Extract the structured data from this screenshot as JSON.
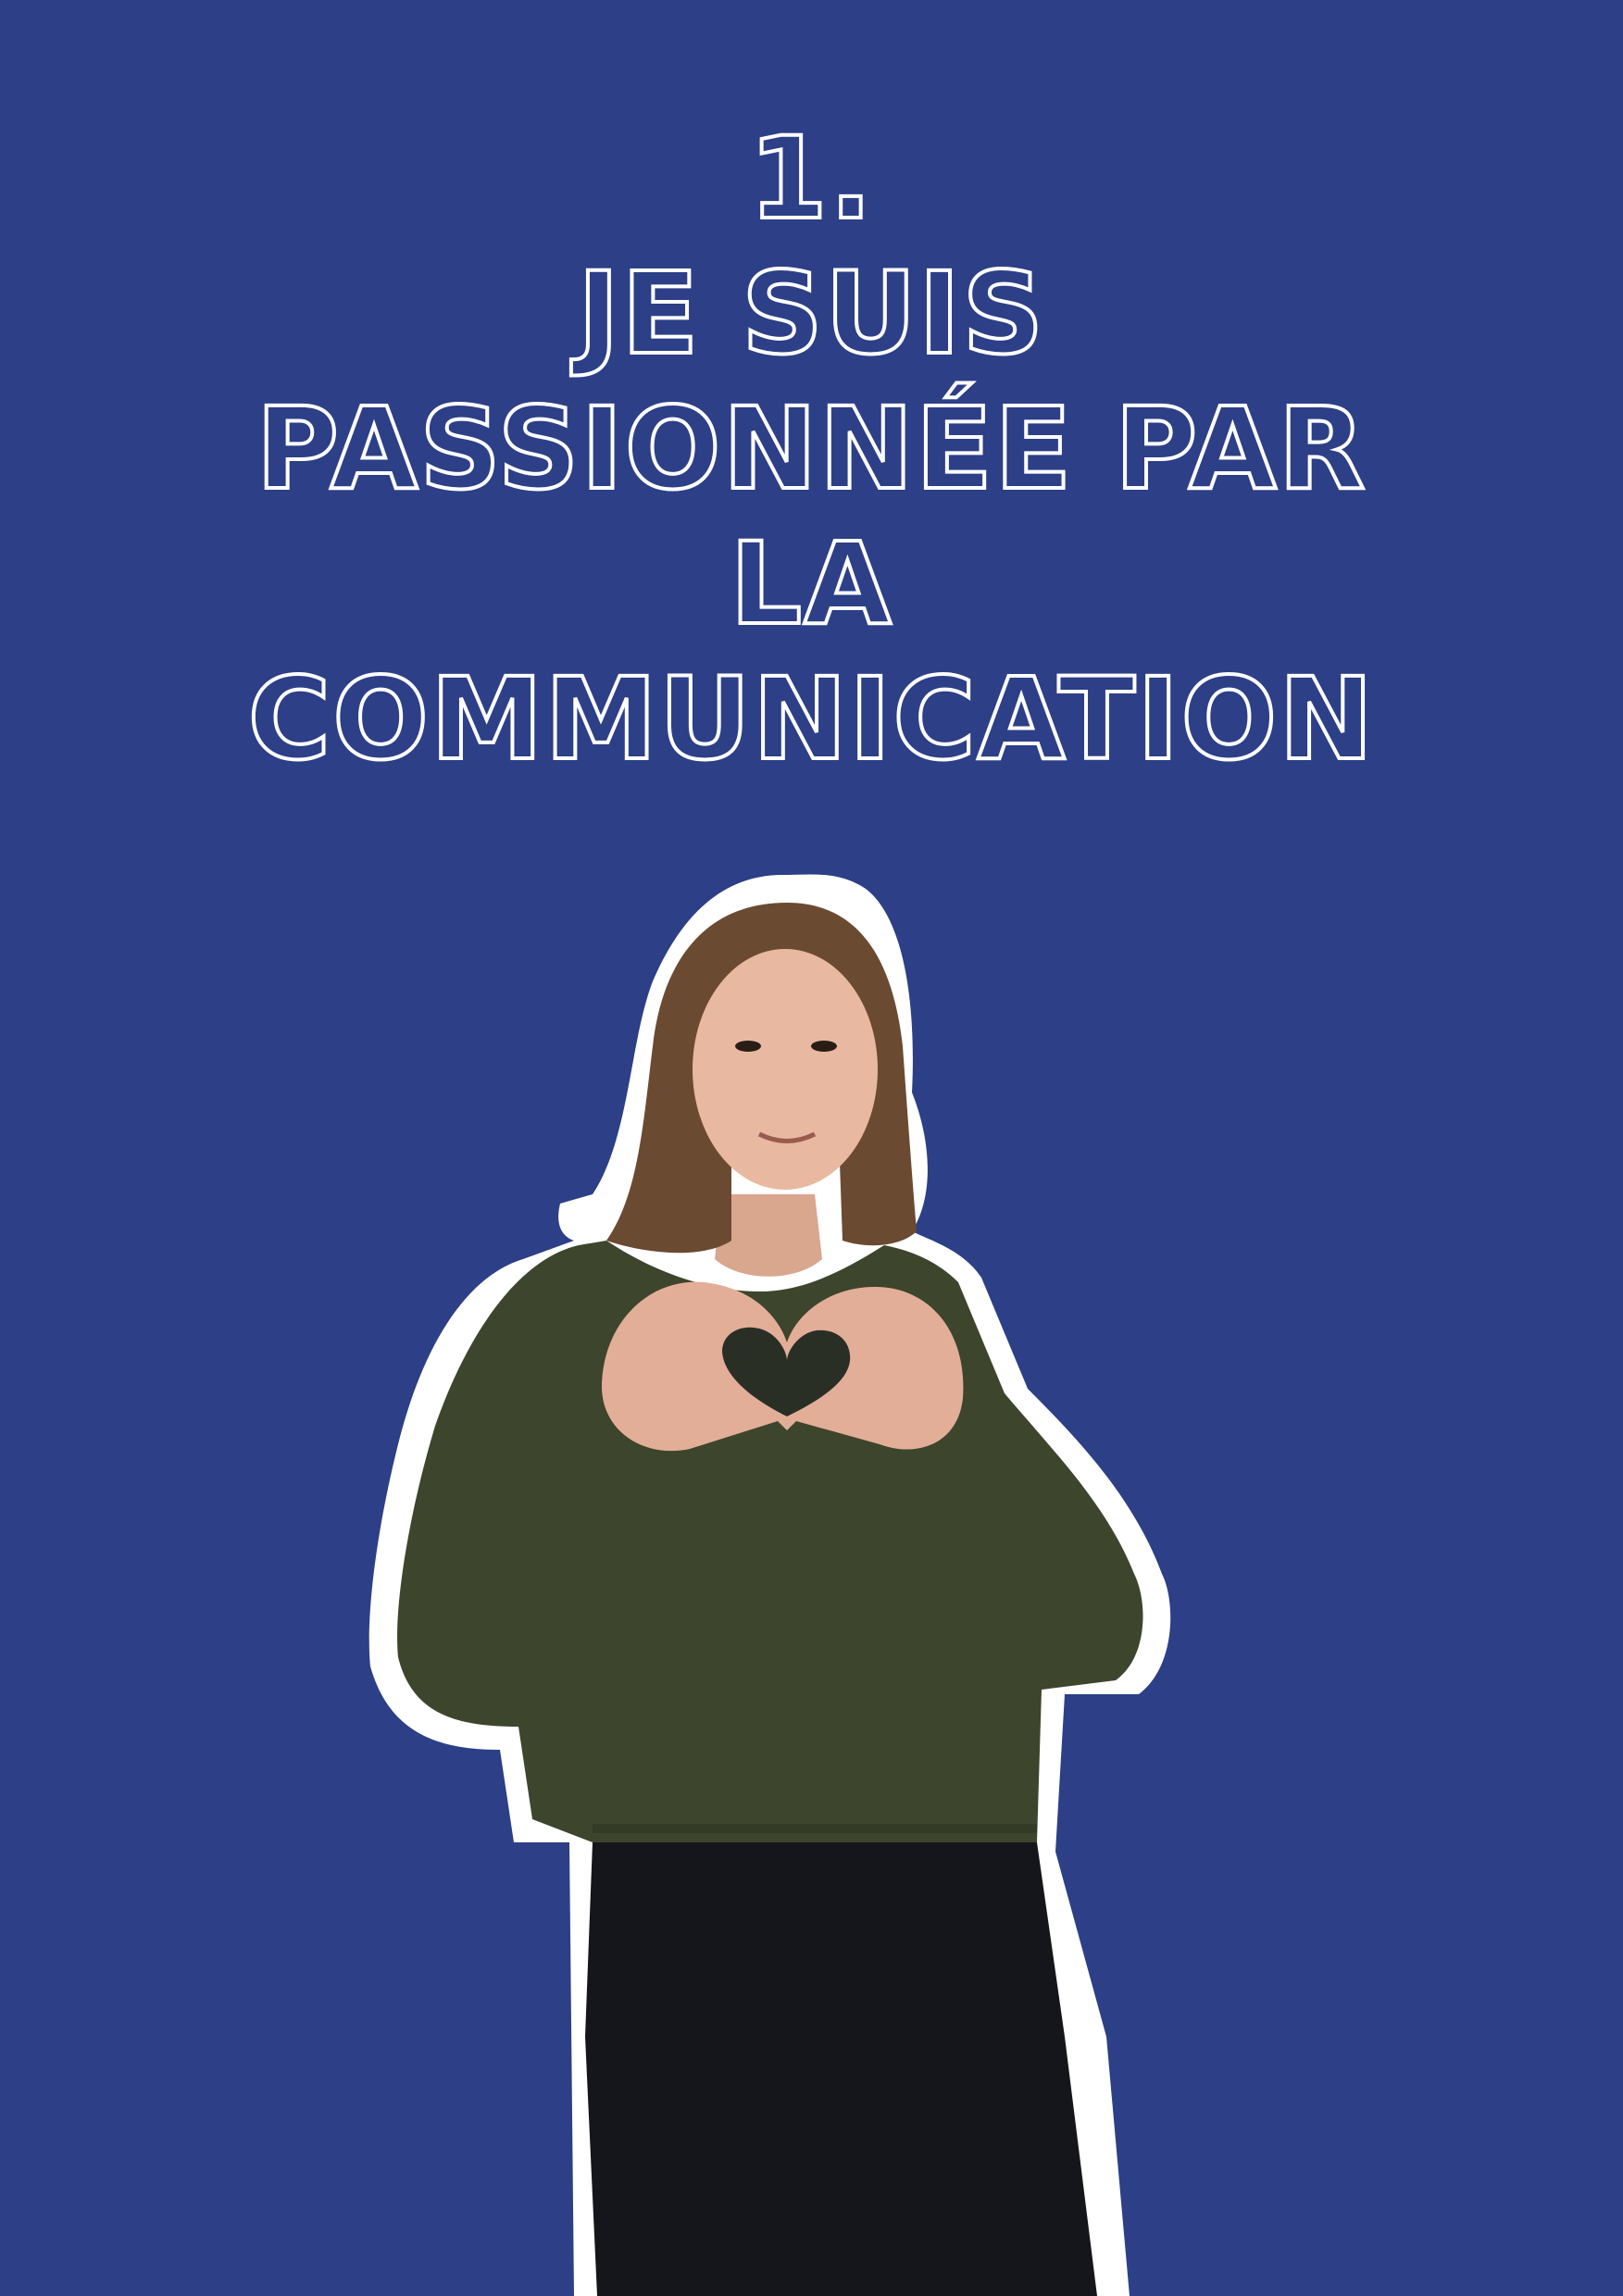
{
  "headline": {
    "number": "1.",
    "line1": "JE SUIS",
    "line2": "PASSIONNÉE PAR",
    "line3": "LA",
    "line4": "COMMUNICATION"
  },
  "photo": {
    "subject": "person-making-heart-hands"
  },
  "colors": {
    "background": "#2c3f87",
    "outline": "#ffffff",
    "sweater": "#3d452c",
    "pants": "#15161b",
    "hair": "#6b4a32",
    "skin": "#e8b8a0"
  }
}
